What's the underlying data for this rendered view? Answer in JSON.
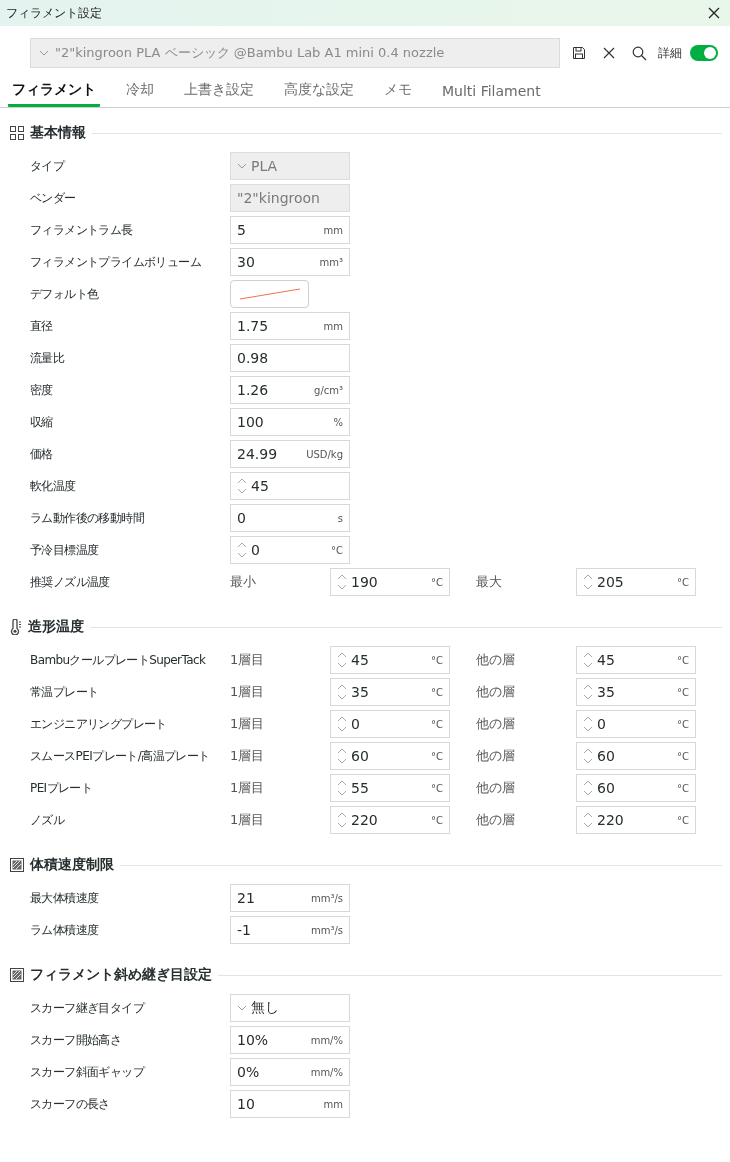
{
  "window": {
    "title": "フィラメント設定"
  },
  "preset": {
    "value": "\"2\"kingroon PLA ベーシック @Bambu Lab A1 mini 0.4 nozzle"
  },
  "toolbar": {
    "advanced_label": "詳細",
    "advanced_on": true
  },
  "tabs": [
    {
      "label": "フィラメント",
      "selected": true
    },
    {
      "label": "冷却",
      "selected": false
    },
    {
      "label": "上書き設定",
      "selected": false
    },
    {
      "label": "高度な設定",
      "selected": false
    },
    {
      "label": "メモ",
      "selected": false
    },
    {
      "label": "Multi Filament",
      "selected": false
    }
  ],
  "sections": [
    {
      "title": "基本情報",
      "kind": "grid",
      "rows": [
        {
          "kind": "select",
          "label": "タイプ",
          "value": "PLA",
          "disabled": true
        },
        {
          "kind": "text",
          "label": "ベンダー",
          "value": "\"2\"kingroon",
          "disabled": true
        },
        {
          "kind": "input",
          "label": "フィラメントラム長",
          "value": "5",
          "unit": "mm"
        },
        {
          "kind": "input",
          "label": "フィラメントプライムボリューム",
          "value": "30",
          "unit": "mm³"
        },
        {
          "kind": "color",
          "label": "デフォルト色"
        },
        {
          "kind": "input",
          "label": "直径",
          "value": "1.75",
          "unit": "mm"
        },
        {
          "kind": "input",
          "label": "流量比",
          "value": "0.98"
        },
        {
          "kind": "input",
          "label": "密度",
          "value": "1.26",
          "unit": "g/cm³"
        },
        {
          "kind": "input",
          "label": "収縮",
          "value": "100",
          "unit": "%"
        },
        {
          "kind": "input",
          "label": "価格",
          "value": "24.99",
          "unit": "USD/kg"
        },
        {
          "kind": "spin",
          "label": "軟化温度",
          "value": "45"
        },
        {
          "kind": "input",
          "label": "ラム動作後の移動時間",
          "value": "0",
          "unit": "s"
        },
        {
          "kind": "spin",
          "label": "予冷目標温度",
          "value": "0",
          "unit": "°C"
        },
        {
          "kind": "pair",
          "label": "推奨ノズル温度",
          "label_a": "最小",
          "value_a": "190",
          "unit_a": "°C",
          "label_b": "最大",
          "value_b": "205",
          "unit_b": "°C"
        }
      ]
    },
    {
      "title": "造形温度",
      "kind": "thermometer",
      "rows": [
        {
          "kind": "pair",
          "label": "BambuクールプレートSuperTack",
          "label_a": "1層目",
          "value_a": "45",
          "unit_a": "°C",
          "label_b": "他の層",
          "value_b": "45",
          "unit_b": "°C"
        },
        {
          "kind": "pair",
          "label": "常温プレート",
          "label_a": "1層目",
          "value_a": "35",
          "unit_a": "°C",
          "label_b": "他の層",
          "value_b": "35",
          "unit_b": "°C"
        },
        {
          "kind": "pair",
          "label": "エンジニアリングプレート",
          "label_a": "1層目",
          "value_a": "0",
          "unit_a": "°C",
          "label_b": "他の層",
          "value_b": "0",
          "unit_b": "°C"
        },
        {
          "kind": "pair",
          "label": "スムースPEIプレート/高温プレート",
          "label_a": "1層目",
          "value_a": "60",
          "unit_a": "°C",
          "label_b": "他の層",
          "value_b": "60",
          "unit_b": "°C"
        },
        {
          "kind": "pair",
          "label": "PEIプレート",
          "label_a": "1層目",
          "value_a": "55",
          "unit_a": "°C",
          "label_b": "他の層",
          "value_b": "60",
          "unit_b": "°C"
        },
        {
          "kind": "pair",
          "label": "ノズル",
          "label_a": "1層目",
          "value_a": "220",
          "unit_a": "°C",
          "label_b": "他の層",
          "value_b": "220",
          "unit_b": "°C"
        }
      ]
    },
    {
      "title": "体積速度制限",
      "kind": "hatched",
      "rows": [
        {
          "kind": "input",
          "label": "最大体積速度",
          "value": "21",
          "unit": "mm³/s"
        },
        {
          "kind": "input",
          "label": "ラム体積速度",
          "value": "-1",
          "unit": "mm³/s"
        }
      ]
    },
    {
      "title": "フィラメント斜め継ぎ目設定",
      "kind": "hatched",
      "rows": [
        {
          "kind": "select",
          "label": "スカーフ継ぎ目タイプ",
          "value": "無し",
          "disabled": false
        },
        {
          "kind": "input",
          "label": "スカーフ開始高さ",
          "value": "10%",
          "unit": "mm/%"
        },
        {
          "kind": "input",
          "label": "スカーフ斜面ギャップ",
          "value": "0%",
          "unit": "mm/%"
        },
        {
          "kind": "input",
          "label": "スカーフの長さ",
          "value": "10",
          "unit": "mm"
        }
      ]
    }
  ]
}
